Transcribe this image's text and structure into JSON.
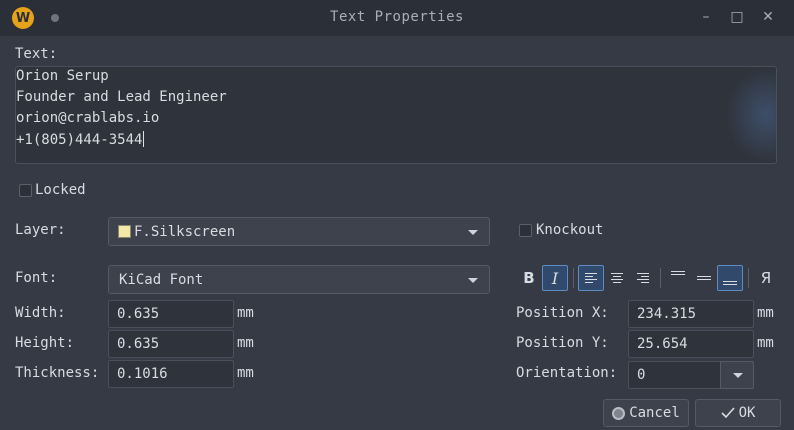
{
  "window": {
    "title": "Text Properties",
    "logo_letter": "W",
    "minimize_glyph": "–",
    "maximize_glyph": "□",
    "close_glyph": "✕"
  },
  "text_section": {
    "label": "Text:",
    "lines": [
      "Orion Serup",
      "Founder and Lead Engineer",
      "orion@crablabs.io",
      "+1(805)444-3544"
    ]
  },
  "locked": {
    "label": "Locked",
    "checked": false
  },
  "layer": {
    "label": "Layer:",
    "value": "F.Silkscreen",
    "swatch_color": "#f2e8a8"
  },
  "knockout": {
    "label": "Knockout",
    "checked": false
  },
  "font": {
    "label": "Font:",
    "value": "KiCad Font"
  },
  "format_toolbar": {
    "bold": "B",
    "italic": "I",
    "mirror": "Я",
    "italic_active": true,
    "halign_active": "left",
    "valign_active": "bottom"
  },
  "size_fields": {
    "width": {
      "label": "Width:",
      "value": "0.635",
      "unit": "mm"
    },
    "height": {
      "label": "Height:",
      "value": "0.635",
      "unit": "mm"
    },
    "thickness": {
      "label": "Thickness:",
      "value": "0.1016",
      "unit": "mm"
    }
  },
  "position_fields": {
    "x": {
      "label": "Position X:",
      "value": "234.315",
      "unit": "mm"
    },
    "y": {
      "label": "Position Y:",
      "value": "25.654",
      "unit": "mm"
    },
    "orientation": {
      "label": "Orientation:",
      "value": "0"
    }
  },
  "buttons": {
    "cancel": "Cancel",
    "ok": "OK"
  },
  "colors": {
    "background": "#353a44",
    "titlebar": "#2b2f37",
    "accent": "#5f8bc4",
    "logo": "#e6a21a"
  }
}
